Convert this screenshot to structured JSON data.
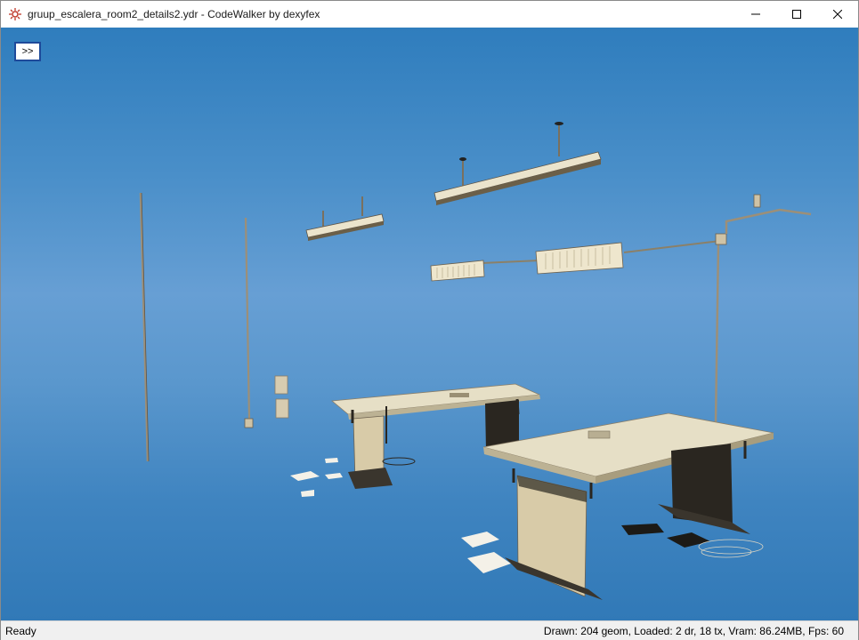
{
  "window": {
    "title": "gruup_escalera_room2_details2.ydr - CodeWalker by dexyfex",
    "app_icon": "codewalker-gear-icon",
    "controls": {
      "minimize_icon": "minimize-icon",
      "maximize_icon": "maximize-icon",
      "close_icon": "close-icon"
    }
  },
  "viewport": {
    "toggle_button_label": ">>",
    "scene_description_colors": {
      "sky_top": "#2f7dbd",
      "sky_mid": "#679fd4",
      "desk_top": "#e6dfc6",
      "desk_leg": "#d8cba8"
    }
  },
  "statusbar": {
    "status": "Ready",
    "stats": "Drawn: 204 geom, Loaded: 2 dr, 18 tx, Vram: 86.24MB, Fps: 60"
  }
}
